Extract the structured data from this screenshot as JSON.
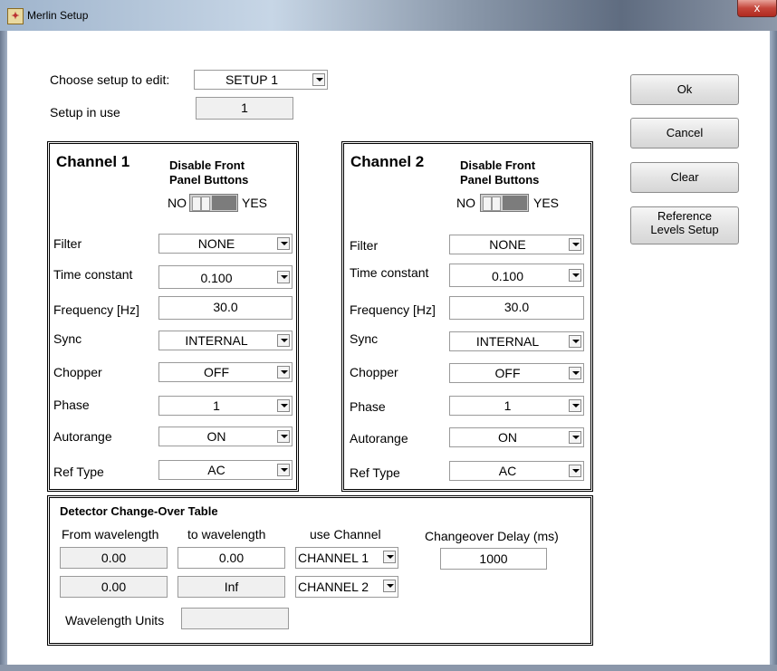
{
  "window": {
    "title": "Merlin Setup",
    "close_glyph": "x"
  },
  "setup": {
    "choose_label": "Choose setup to edit:",
    "choose_value": "SETUP 1",
    "in_use_label": "Setup in use",
    "in_use_value": "1"
  },
  "buttons": {
    "ok": "Ok",
    "cancel": "Cancel",
    "clear": "Clear",
    "ref_line1": "Reference",
    "ref_line2": "Levels Setup"
  },
  "channel1": {
    "title": "Channel 1",
    "disable_line1": "Disable Front",
    "disable_line2": "Panel Buttons",
    "toggle_no": "NO",
    "toggle_yes": "YES",
    "filter_label": "Filter",
    "filter_value": "NONE",
    "tc_label": "Time constant",
    "tc_value": "0.100",
    "freq_label": "Frequency [Hz]",
    "freq_value": "30.0",
    "sync_label": "Sync",
    "sync_value": "INTERNAL",
    "chopper_label": "Chopper",
    "chopper_value": "OFF",
    "phase_label": "Phase",
    "phase_value": "1",
    "autorange_label": "Autorange",
    "autorange_value": "ON",
    "reftype_label": "Ref Type",
    "reftype_value": "AC"
  },
  "channel2": {
    "title": "Channel 2",
    "disable_line1": "Disable Front",
    "disable_line2": "Panel Buttons",
    "toggle_no": "NO",
    "toggle_yes": "YES",
    "filter_label": "Filter",
    "filter_value": "NONE",
    "tc_label": "Time constant",
    "tc_value": "0.100",
    "freq_label": "Frequency [Hz]",
    "freq_value": "30.0",
    "sync_label": "Sync",
    "sync_value": "INTERNAL",
    "chopper_label": "Chopper",
    "chopper_value": "OFF",
    "phase_label": "Phase",
    "phase_value": "1",
    "autorange_label": "Autorange",
    "autorange_value": "ON",
    "reftype_label": "Ref Type",
    "reftype_value": "AC"
  },
  "detector": {
    "title": "Detector Change-Over Table",
    "col_from": "From wavelength",
    "col_to": "to wavelength",
    "col_channel": "use Channel",
    "col_delay": "Changeover Delay (ms)",
    "rows": [
      {
        "from": "0.00",
        "to": "0.00",
        "channel": "CHANNEL 1"
      },
      {
        "from": "0.00",
        "to": "Inf",
        "channel": "CHANNEL 2"
      }
    ],
    "delay_value": "1000",
    "units_label": "Wavelength Units",
    "units_value": ""
  },
  "icons": {
    "title_icon": "labview-app-icon",
    "dropdown": "chevron-down-icon"
  }
}
